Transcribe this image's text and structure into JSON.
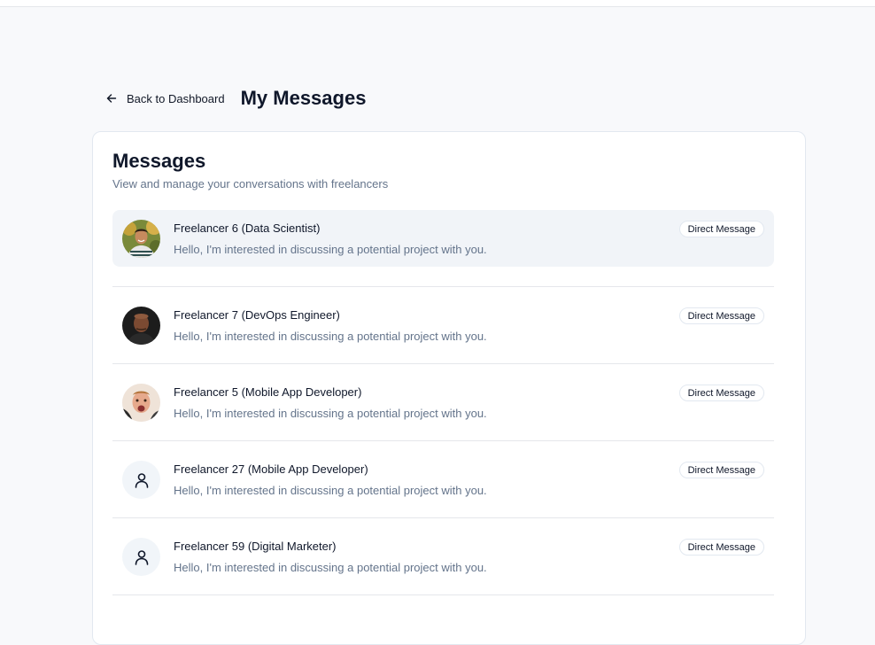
{
  "header": {
    "back_label": "Back to Dashboard",
    "title": "My Messages"
  },
  "card": {
    "title": "Messages",
    "description": "View and manage your conversations with freelancers"
  },
  "conversations": [
    {
      "name": "Freelancer 6 (Data Scientist)",
      "preview": "Hello, I'm interested in discussing a potential project with you.",
      "badge": "Direct Message",
      "avatar": "photo"
    },
    {
      "name": "Freelancer 7 (DevOps Engineer)",
      "preview": "Hello, I'm interested in discussing a potential project with you.",
      "badge": "Direct Message",
      "avatar": "photo"
    },
    {
      "name": "Freelancer 5 (Mobile App Developer)",
      "preview": "Hello, I'm interested in discussing a potential project with you.",
      "badge": "Direct Message",
      "avatar": "photo"
    },
    {
      "name": "Freelancer 27 (Mobile App Developer)",
      "preview": "Hello, I'm interested in discussing a potential project with you.",
      "badge": "Direct Message",
      "avatar": "user-icon"
    },
    {
      "name": "Freelancer 59 (Digital Marketer)",
      "preview": "Hello, I'm interested in discussing a potential project with you.",
      "badge": "Direct Message",
      "avatar": "user-icon"
    }
  ]
}
